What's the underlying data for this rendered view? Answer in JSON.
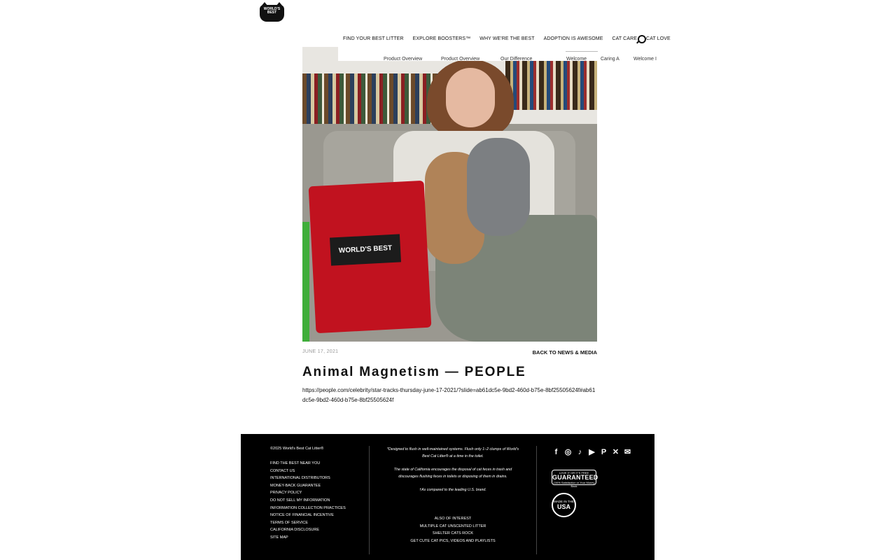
{
  "header": {
    "logo_text": "WORLD'S BEST",
    "nav": [
      "FIND YOUR BEST LITTER",
      "EXPLORE BOOSTERS™",
      "WHY WE'RE THE BEST",
      "ADOPTION IS AWESOME",
      "CAT CARE",
      "CAT LOVE"
    ],
    "subnav": [
      "Product Overview",
      "Product Overview",
      "Our Difference",
      "Welcome",
      "Caring A",
      "Welcome I"
    ]
  },
  "article": {
    "date": "JUNE 17, 2021",
    "back_link": "BACK TO NEWS & MEDIA",
    "title": "Animal Magnetism — PEOPLE",
    "url": "https://people.com/celebrity/star-tracks-thursday-june-17-2021/?slide=ab61dc5e-9bd2-460d-b75e-8bf25505624f#ab61dc5e-9bd2-460d-b75e-8bf25505624f"
  },
  "footer": {
    "copyright": "©2025 World's Best Cat Litter®",
    "links": [
      "FIND THE BEST NEAR YOU",
      "CONTACT US",
      "INTERNATIONAL DISTRIBUTORS",
      "MONEY-BACK GUARANTEE",
      "PRIVACY POLICY",
      "DO NOT SELL MY INFORMATION",
      "INFORMATION COLLECTION PRACTICES",
      "NOTICE OF FINANCIAL INCENTIVE",
      "TERMS OF SERVICE",
      "CALIFORNIA DISCLOSURE",
      "SITE MAP"
    ],
    "disclaimer": [
      "*Designed to flush in well-maintained systems. Flush only 1–2 clumps of World's Best Cat Litter® at a time in the toilet.",
      "The state of California encourages the disposal of cat feces in trash and discourages flushing feces in toilets or disposing of them in drains.",
      "†As compared to the leading U.S. brand."
    ],
    "interest": [
      "ALSO OF INTEREST",
      "MULTIPLE CAT UNSCENTED LITTER",
      "SHELTER CATS ROCK",
      "GET CUTE CAT PICS, VIDEOS AND PLAYLISTS"
    ],
    "social_icons": [
      "facebook-icon",
      "instagram-icon",
      "tiktok-icon",
      "youtube-icon",
      "pinterest-icon",
      "x-icon",
      "email-icon"
    ],
    "guarantee_top": "LOVE IT OR IT'S FREE",
    "guarantee_main": "GUARANTEED",
    "guarantee_bottom": "100% Satisfaction or Your Money Back",
    "usa_top": "MADE IN THE",
    "usa_main": "USA"
  }
}
